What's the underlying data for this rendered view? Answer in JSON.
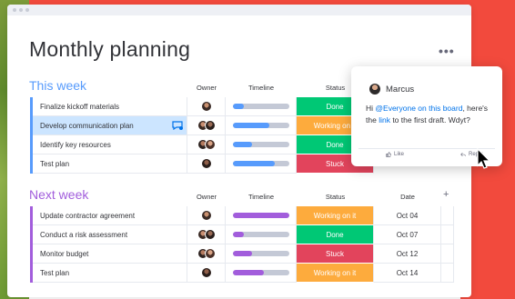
{
  "page": {
    "title": "Monthly planning",
    "more_label": "•••"
  },
  "groups": [
    {
      "title": "This week",
      "color": "#579bfc",
      "columns": {
        "owner": "Owner",
        "timeline": "Timeline",
        "status": "Status"
      },
      "rows": [
        {
          "name": "Finalize kickoff materials",
          "status": "Done",
          "status_color": "#00c875",
          "timeline_progress": 0.2,
          "timeline_color": "#579bfc",
          "highlighted": false
        },
        {
          "name": "Develop communication plan",
          "status": "Working on it",
          "status_color": "#fdab3d",
          "timeline_progress": 0.65,
          "timeline_color": "#579bfc",
          "highlighted": true
        },
        {
          "name": "Identify key resources",
          "status": "Done",
          "status_color": "#00c875",
          "timeline_progress": 0.35,
          "timeline_color": "#579bfc",
          "highlighted": false
        },
        {
          "name": "Test plan",
          "status": "Stuck",
          "status_color": "#e2445c",
          "timeline_progress": 0.75,
          "timeline_color": "#579bfc",
          "highlighted": false
        }
      ]
    },
    {
      "title": "Next week",
      "color": "#a25ddc",
      "columns": {
        "owner": "Owner",
        "timeline": "Timeline",
        "status": "Status",
        "date": "Date",
        "add": "+"
      },
      "rows": [
        {
          "name": "Update contractor agreement",
          "status": "Working on it",
          "status_color": "#fdab3d",
          "date": "Oct 04",
          "timeline_progress": 1.0,
          "timeline_color": "#a25ddc"
        },
        {
          "name": "Conduct a risk assessment",
          "status": "Done",
          "status_color": "#00c875",
          "date": "Oct 07",
          "timeline_progress": 0.2,
          "timeline_color": "#a25ddc"
        },
        {
          "name": "Monitor budget",
          "status": "Stuck",
          "status_color": "#e2445c",
          "date": "Oct 12",
          "timeline_progress": 0.35,
          "timeline_color": "#a25ddc"
        },
        {
          "name": "Test plan",
          "status": "Working on it",
          "status_color": "#fdab3d",
          "date": "Oct 14",
          "timeline_progress": 0.55,
          "timeline_color": "#a25ddc"
        }
      ]
    }
  ],
  "comment_popup": {
    "author": "Marcus",
    "message_prefix": "Hi ",
    "mention": "@Everyone on this board",
    "message_mid": ", here's the ",
    "link_text": "link",
    "message_suffix": " to the first draft. Wdyt?",
    "like_label": "Like",
    "reply_label": "Reply"
  },
  "icons": [
    "chat-bubble-icon",
    "thumbs-up-icon",
    "reply-icon",
    "mouse-cursor-icon",
    "more-options-icon"
  ]
}
